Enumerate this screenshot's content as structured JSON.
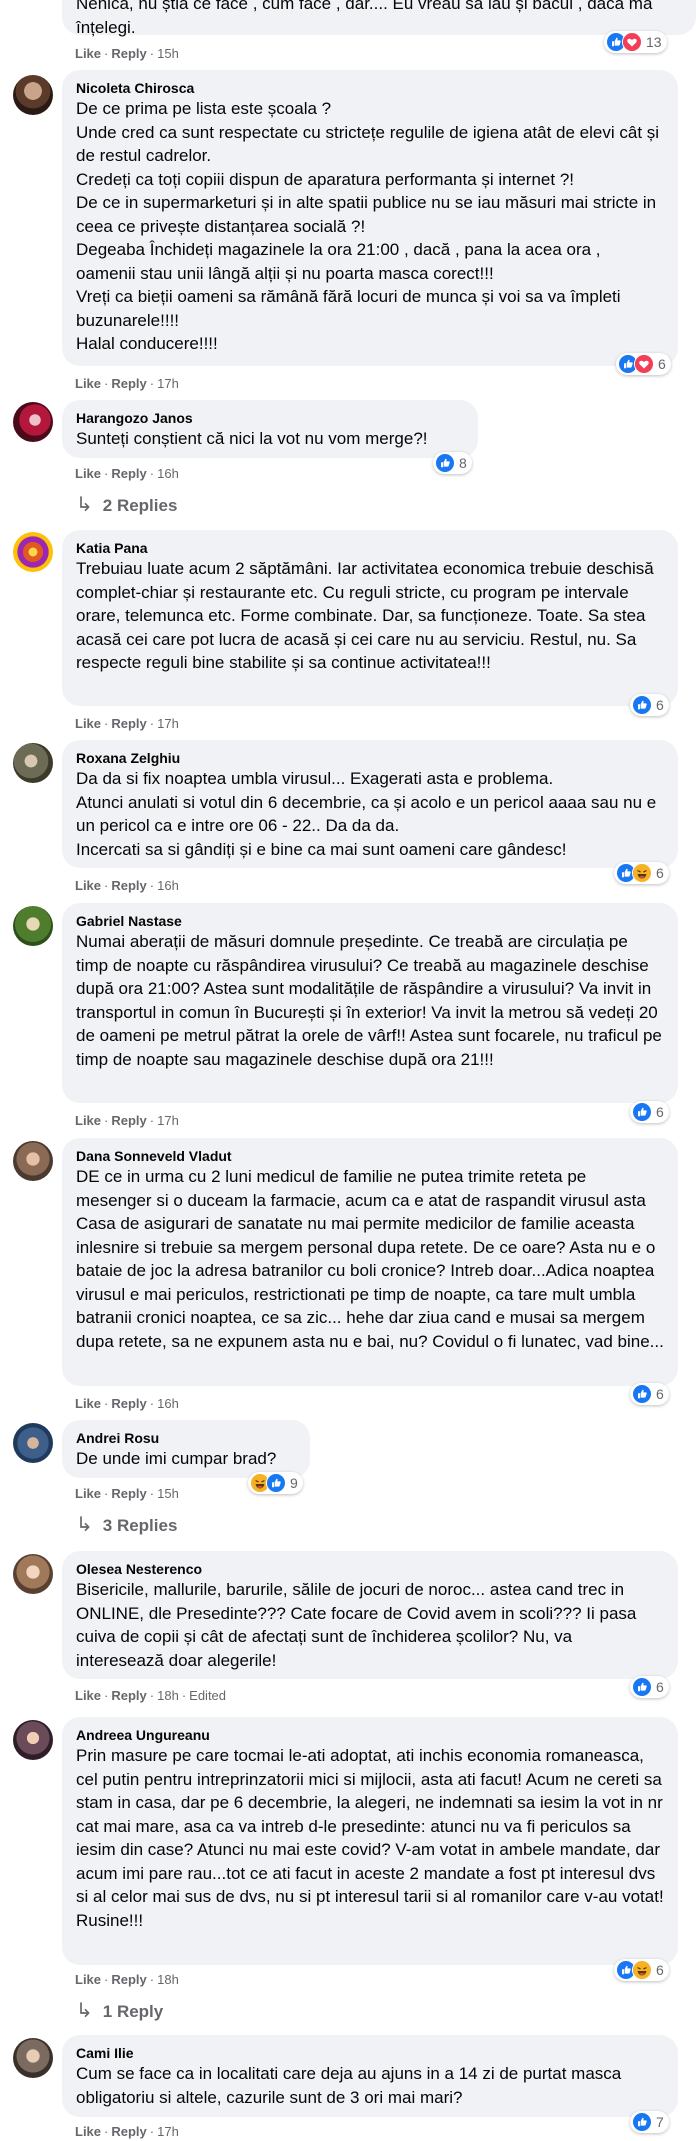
{
  "colors": {
    "bubble": "#f0f2f5",
    "meta": "#65676b",
    "like_blue": "#1877f2",
    "love_red": "#f33e58",
    "haha_yellow": "#f7b125"
  },
  "labels": {
    "like": "Like",
    "reply": "Reply",
    "sep": "·"
  },
  "top": {
    "text_partial": "Nenica, nu știa ce face , cum face , dar.... Eu vreau să iau și bacul , dacă mă înțelegi.",
    "time": "15h",
    "count": "13",
    "reactions": [
      "like",
      "love"
    ]
  },
  "comments": [
    {
      "author": "Nicoleta Chirosca",
      "text": "De ce prima pe lista este școala ?\nUnde cred ca sunt respectate cu strictețe regulile de igiena atât de elevi cât și de restul cadrelor.\nCredeți ca toți copiii dispun de aparatura performanta și internet ?!\nDe ce in supermarketuri și in alte spatii publice nu se iau măsuri mai stricte in ceea ce privește distanțarea socială ?!\nDegeaba Închideți magazinele la ora 21:00 , dacă , pana la acea ora , oamenii stau unii lângă alții și nu poarta masca corect!!!\nVreți ca bieții oameni sa rămână fără locuri de munca și voi sa va împleti buzunarele!!!!\nHalal conducere!!!!",
      "time": "17h",
      "count": "6",
      "reactions": [
        "like",
        "love"
      ],
      "avatar": "avatar-nicoleta"
    },
    {
      "author": "Harangozo Janos",
      "text": "Sunteți conștient că nici la vot nu vom merge?!",
      "time": "16h",
      "count": "8",
      "reactions": [
        "like"
      ],
      "replies": "2 Replies",
      "avatar": "avatar-harangozo"
    },
    {
      "author": "Katia Pana",
      "text": "Trebuiau luate acum 2 săptămâni. Iar activitatea economica trebuie deschisă complet-chiar și restaurante etc. Cu reguli stricte, cu program pe intervale orare, telemunca etc. Forme combinate. Dar, sa funcționeze. Toate. Sa stea acasă cei care pot lucra de acasă și cei care nu au serviciu. Restul, nu. Sa respecte reguli bine stabilite și sa continue activitatea!!!",
      "time": "17h",
      "count": "6",
      "reactions": [
        "like"
      ],
      "avatar": "avatar-katia"
    },
    {
      "author": "Roxana Zelghiu",
      "text": "Da da si fix noaptea umbla virusul... Exagerati asta e problema.\nAtunci anulati si votul din 6 decembrie, ca și acolo e un pericol aaaa sau nu e un pericol ca e intre ore 06 - 22.. Da da da.\nIncercati sa si gândiți și e bine ca mai sunt oameni care gândesc!",
      "time": "16h",
      "count": "6",
      "reactions": [
        "like",
        "haha"
      ],
      "avatar": "avatar-roxana"
    },
    {
      "author": "Gabriel Nastase",
      "text": "Numai aberații de măsuri domnule președinte. Ce treabă are circulația pe timp de noapte cu răspândirea virusului? Ce treabă au magazinele deschise după ora 21:00? Astea sunt modalitățile de răspândire a virusului? Va invit in transportul in comun în București și în exterior! Va invit la metrou să vedeți 20 de oameni pe metrul pătrat la orele de vârf!! Astea sunt focarele, nu traficul pe timp de noapte sau magazinele deschise după ora 21!!!",
      "time": "17h",
      "count": "6",
      "reactions": [
        "like"
      ],
      "avatar": "avatar-gabriel"
    },
    {
      "author": "Dana Sonneveld Vladut",
      "text": "DE ce in urma cu 2 luni medicul de familie ne putea trimite reteta pe mesenger si o duceam la farmacie, acum ca e atat de raspandit virusul asta Casa de asigurari de sanatate nu mai permite medicilor de familie aceasta inlesnire si trebuie sa mergem personal dupa retete. De ce oare? Asta nu e o bataie de joc la adresa batranilor cu boli cronice? Intreb doar...Adica noaptea virusul e mai periculos, restrictionati pe timp de noapte, ca tare mult umbla batranii cronici noaptea, ce sa zic... hehe dar ziua cand e musai sa mergem dupa retete, sa ne expunem asta nu e bai, nu? Covidul o fi lunatec, vad bine...",
      "time": "16h",
      "count": "6",
      "reactions": [
        "like"
      ],
      "avatar": "avatar-dana"
    },
    {
      "author": "Andrei Rosu",
      "text": "De unde imi cumpar brad?",
      "time": "15h",
      "count": "9",
      "reactions": [
        "haha",
        "like"
      ],
      "replies": "3 Replies",
      "avatar": "avatar-andrei"
    },
    {
      "author": "Olesea Nesterenco",
      "text": "Bisericile, mallurile, barurile, sălile de jocuri de noroc... astea cand trec in ONLINE, dle Presedinte??? Cate focare de Covid avem in scoli??? Ii pasa cuiva de copii și cât de afectați sunt de închiderea școlilor? Nu, va interesează doar alegerile!",
      "time": "18h",
      "edited": "Edited",
      "count": "6",
      "reactions": [
        "like"
      ],
      "avatar": "avatar-olesea"
    },
    {
      "author": "Andreea Ungureanu",
      "text": "Prin masure pe care tocmai le-ati adoptat, ati inchis economia romaneasca, cel putin pentru intreprinzatorii mici si mijlocii, asta ati facut! Acum ne cereti sa stam in casa, dar pe 6 decembrie, la alegeri, ne indemnati sa iesim la vot in nr cat mai mare, asa ca va intreb d-le presedinte: atunci nu va fi periculos sa iesim din case? Atunci nu mai este covid? V-am votat in ambele mandate, dar acum imi pare rau...tot ce ati facut in aceste 2 mandate a fost pt interesul dvs si al celor mai sus de dvs, nu si pt interesul tarii si al romanilor care v-au votat! Rusine!!!",
      "time": "18h",
      "count": "6",
      "reactions": [
        "like",
        "haha"
      ],
      "replies": "1 Reply",
      "avatar": "avatar-andreea"
    },
    {
      "author": "Cami Ilie",
      "text": "Cum se face ca in localitati care deja au ajuns in a 14 zi de purtat masca obligatoriu si altele, cazurile sunt de 3 ori mai mari?",
      "time": "17h",
      "count": "7",
      "reactions": [
        "like"
      ],
      "avatar": "avatar-cami"
    }
  ]
}
